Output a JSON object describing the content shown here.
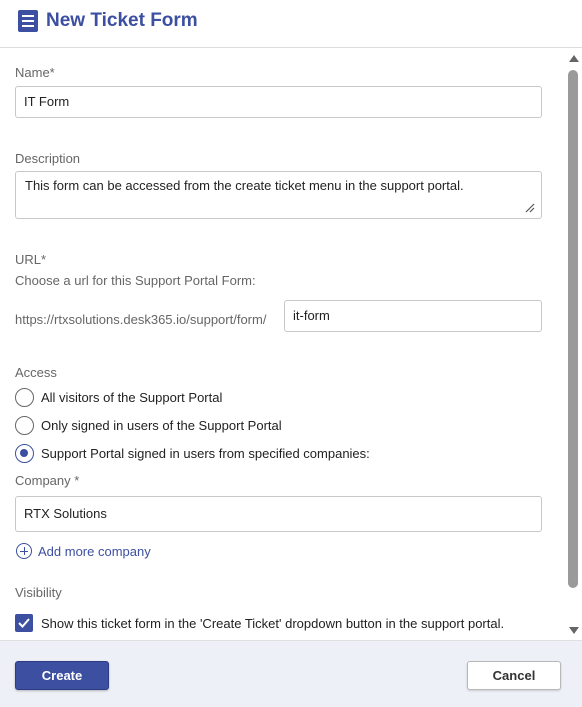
{
  "header": {
    "title": "New Ticket Form",
    "icon": "form-list-icon"
  },
  "form": {
    "name": {
      "label": "Name*",
      "value": "IT Form"
    },
    "description": {
      "label": "Description",
      "value": "This form can be accessed from the create ticket menu in the support portal."
    },
    "url": {
      "label": "URL*",
      "hint": "Choose a url for this Support Portal Form:",
      "prefix": "https://rtxsolutions.desk365.io/support/form/",
      "value": "it-form"
    },
    "access": {
      "label": "Access",
      "options": [
        {
          "label": "All visitors of the Support Portal",
          "checked": false
        },
        {
          "label": "Only signed in users of the Support Portal",
          "checked": false
        },
        {
          "label": "Support Portal signed in users from specified companies:",
          "checked": true
        }
      ]
    },
    "company": {
      "label": "Company *",
      "value": "RTX Solutions"
    },
    "add_company": "Add more company",
    "visibility": {
      "label": "Visibility",
      "checkbox_label": "Show this ticket form in the 'Create Ticket' dropdown button in the support portal.",
      "checked": true
    }
  },
  "footer": {
    "create_label": "Create",
    "cancel_label": "Cancel"
  },
  "colors": {
    "accent": "#3c4fa0",
    "footer_bg": "#eef0f7"
  }
}
